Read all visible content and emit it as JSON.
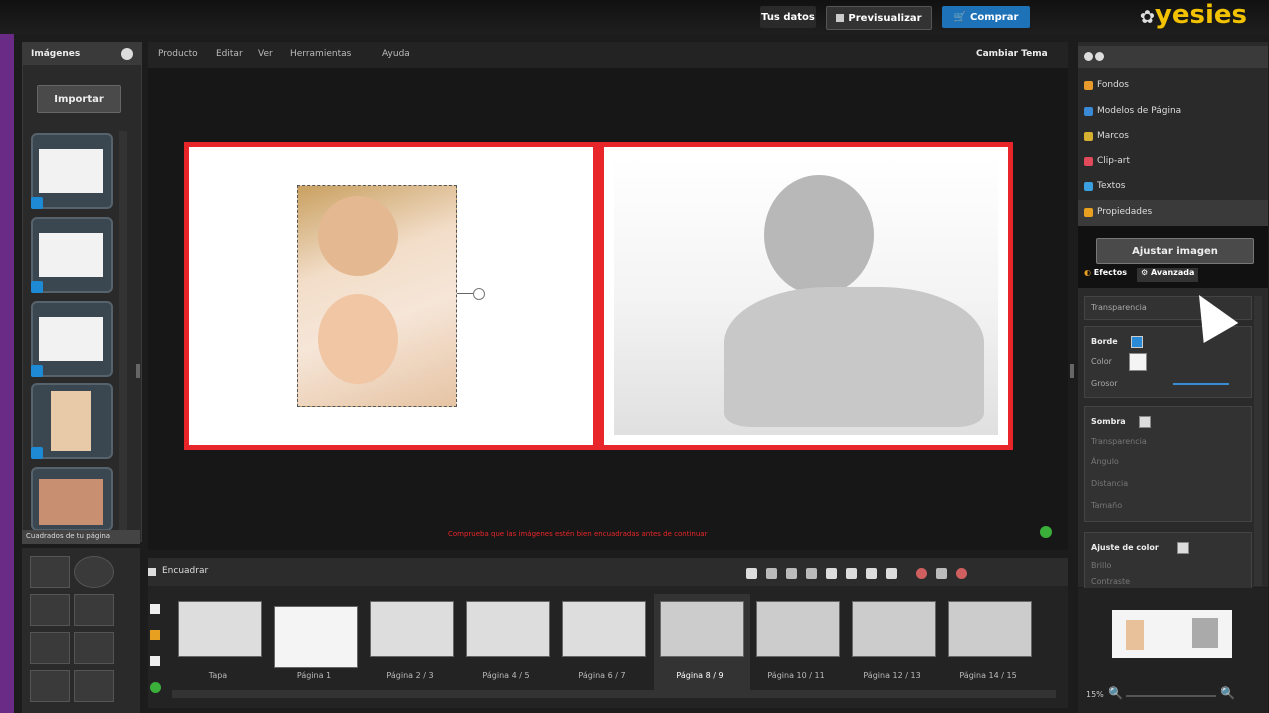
{
  "topbar": {
    "tus_datos": "Tus datos",
    "previsualizar": "Previsualizar",
    "comprar": "Comprar",
    "logo": "yesies"
  },
  "left": {
    "title": "Imágenes",
    "importar": "Importar",
    "bottom_label": "Cuadrados de tu página"
  },
  "menu": [
    "Producto",
    "Editar",
    "Ver",
    "Herramientas",
    "Ayuda"
  ],
  "cambiar_tema": "Cambiar Tema",
  "canvas": {
    "warning": "Comprueba que las imágenes estén bien encuadradas antes de continuar"
  },
  "right": {
    "items": [
      {
        "label": "Fondos",
        "icon": "fondos-icon",
        "color": "#e89a2a"
      },
      {
        "label": "Modelos de Página",
        "icon": "modelos-icon",
        "color": "#3a8ad6"
      },
      {
        "label": "Marcos",
        "icon": "marcos-icon",
        "color": "#d6b030"
      },
      {
        "label": "Clip-art",
        "icon": "clipart-icon",
        "color": "#e04a5a"
      },
      {
        "label": "Textos",
        "icon": "textos-icon",
        "color": "#3aa0e0"
      },
      {
        "label": "Propiedades",
        "icon": "propiedades-icon",
        "color": "#e8a020"
      }
    ],
    "ajustar": "Ajustar imagen",
    "tab_efectos": "Efectos",
    "tab_avanzada": "Avanzada",
    "transparencia": "Transparencia",
    "borde": "Borde",
    "color": "Color",
    "grosor": "Grosor",
    "sombra": "Sombra",
    "sombra_items": [
      "Transparencia",
      "Ángulo",
      "Distancia",
      "Tamaño"
    ],
    "ajuste_color": "Ajuste de color",
    "ajuste_items": [
      "Brillo",
      "Contraste"
    ],
    "zoom": "15%"
  },
  "bottom": {
    "encuadrar": "Encuadrar",
    "pages": [
      "Tapa",
      "Página 1",
      "Página 2 / 3",
      "Página 4 / 5",
      "Página 6 / 7",
      "Página 8 / 9",
      "Página 10 / 11",
      "Página 12 / 13",
      "Página 14 / 15"
    ]
  }
}
